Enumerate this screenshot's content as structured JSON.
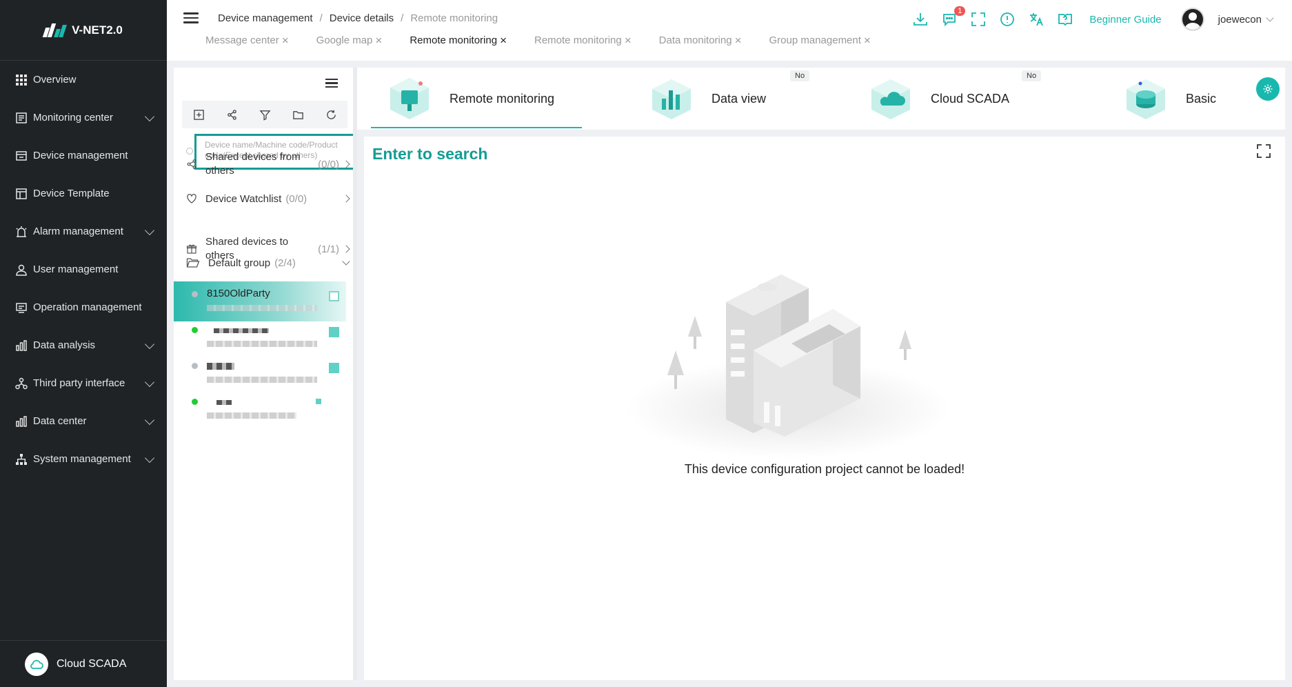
{
  "app": {
    "logo_text": "V-NET2.0"
  },
  "sidebar": {
    "items": [
      {
        "label": "Overview",
        "icon": "grid-icon",
        "expandable": false
      },
      {
        "label": "Monitoring center",
        "icon": "monitor-icon",
        "expandable": true
      },
      {
        "label": "Device management",
        "icon": "device-icon",
        "expandable": false
      },
      {
        "label": "Device Template",
        "icon": "template-icon",
        "expandable": false
      },
      {
        "label": "Alarm management",
        "icon": "alarm-icon",
        "expandable": true
      },
      {
        "label": "User management",
        "icon": "user-icon",
        "expandable": false
      },
      {
        "label": "Operation management",
        "icon": "operation-icon",
        "expandable": false
      },
      {
        "label": "Data analysis",
        "icon": "bar-chart-icon",
        "expandable": true
      },
      {
        "label": "Third party interface",
        "icon": "network-icon",
        "expandable": true
      },
      {
        "label": "Data center",
        "icon": "bar-chart-icon",
        "expandable": true
      },
      {
        "label": "System management",
        "icon": "org-chart-icon",
        "expandable": true
      }
    ],
    "bottom_label": "Cloud SCADA"
  },
  "header": {
    "breadcrumb": [
      "Device management",
      "Device details",
      "Remote monitoring"
    ],
    "tabs": [
      "Message center",
      "Google map",
      "Remote monitoring",
      "Remote monitoring",
      "Data monitoring",
      "Group management"
    ],
    "active_tab_index": 2,
    "message_badge": "1",
    "guide_label": "Beginner Guide",
    "username": "joewecon"
  },
  "device_panel": {
    "search_placeholder": "Device name/Machine code/Product code(Except shared by others)",
    "groups": [
      {
        "label": "Shared devices from others",
        "count": "(0/0)"
      },
      {
        "label": "Device Watchlist",
        "count": "(0/0)"
      },
      {
        "label": "Shared devices to others",
        "count": "(1/1)"
      },
      {
        "label": "Default group",
        "count": "(2/4)"
      }
    ],
    "devices": [
      {
        "name": "8150OldParty",
        "status": "offline",
        "status_color": "#b9bec6"
      },
      {
        "name": "",
        "status": "online",
        "status_color": "#22cc33"
      },
      {
        "name": "",
        "status": "offline",
        "status_color": "#b9bec6"
      },
      {
        "name": "",
        "status": "online",
        "status_color": "#22cc33"
      }
    ]
  },
  "main_tabs": [
    {
      "label": "Remote monitoring",
      "tag": ""
    },
    {
      "label": "Data view",
      "tag": "No"
    },
    {
      "label": "Cloud SCADA",
      "tag": "No"
    },
    {
      "label": "Basic",
      "tag": ""
    }
  ],
  "content": {
    "search_heading": "Enter to search",
    "empty_message": "This device configuration project cannot be loaded!"
  },
  "colors": {
    "accent": "#19b8ae",
    "sidebar_bg": "#1f2326",
    "search_border": "#159c93",
    "badge": "#f05656"
  }
}
